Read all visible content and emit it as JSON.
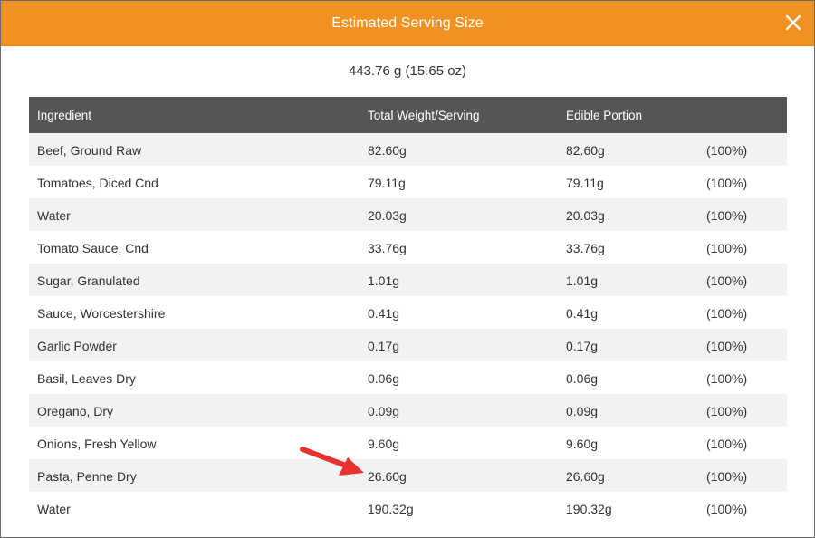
{
  "dialog": {
    "title": "Estimated Serving Size",
    "close_icon": "close-icon",
    "summary": "443.76 g (15.65 oz)",
    "header_color": "#f19122"
  },
  "table": {
    "columns": [
      "Ingredient",
      "Total Weight/Serving",
      "Edible Portion"
    ],
    "rows": [
      {
        "ingredient": "Beef, Ground Raw",
        "total_weight": "82.60g",
        "edible_portion": "82.60g",
        "percent": "(100%)"
      },
      {
        "ingredient": "Tomatoes, Diced Cnd",
        "total_weight": "79.11g",
        "edible_portion": "79.11g",
        "percent": "(100%)"
      },
      {
        "ingredient": "Water",
        "total_weight": "20.03g",
        "edible_portion": "20.03g",
        "percent": "(100%)"
      },
      {
        "ingredient": "Tomato Sauce, Cnd",
        "total_weight": "33.76g",
        "edible_portion": "33.76g",
        "percent": "(100%)"
      },
      {
        "ingredient": "Sugar, Granulated",
        "total_weight": "1.01g",
        "edible_portion": "1.01g",
        "percent": "(100%)"
      },
      {
        "ingredient": "Sauce, Worcestershire",
        "total_weight": "0.41g",
        "edible_portion": "0.41g",
        "percent": "(100%)"
      },
      {
        "ingredient": "Garlic Powder",
        "total_weight": "0.17g",
        "edible_portion": "0.17g",
        "percent": "(100%)"
      },
      {
        "ingredient": "Basil, Leaves Dry",
        "total_weight": "0.06g",
        "edible_portion": "0.06g",
        "percent": "(100%)"
      },
      {
        "ingredient": "Oregano, Dry",
        "total_weight": "0.09g",
        "edible_portion": "0.09g",
        "percent": "(100%)"
      },
      {
        "ingredient": "Onions, Fresh Yellow",
        "total_weight": "9.60g",
        "edible_portion": "9.60g",
        "percent": "(100%)"
      },
      {
        "ingredient": "Pasta, Penne Dry",
        "total_weight": "26.60g",
        "edible_portion": "26.60g",
        "percent": "(100%)"
      },
      {
        "ingredient": "Water",
        "total_weight": "190.32g",
        "edible_portion": "190.32g",
        "percent": "(100%)"
      }
    ]
  },
  "annotation": {
    "arrow_icon": "red-arrow-icon",
    "arrow_color": "#e8322f"
  }
}
